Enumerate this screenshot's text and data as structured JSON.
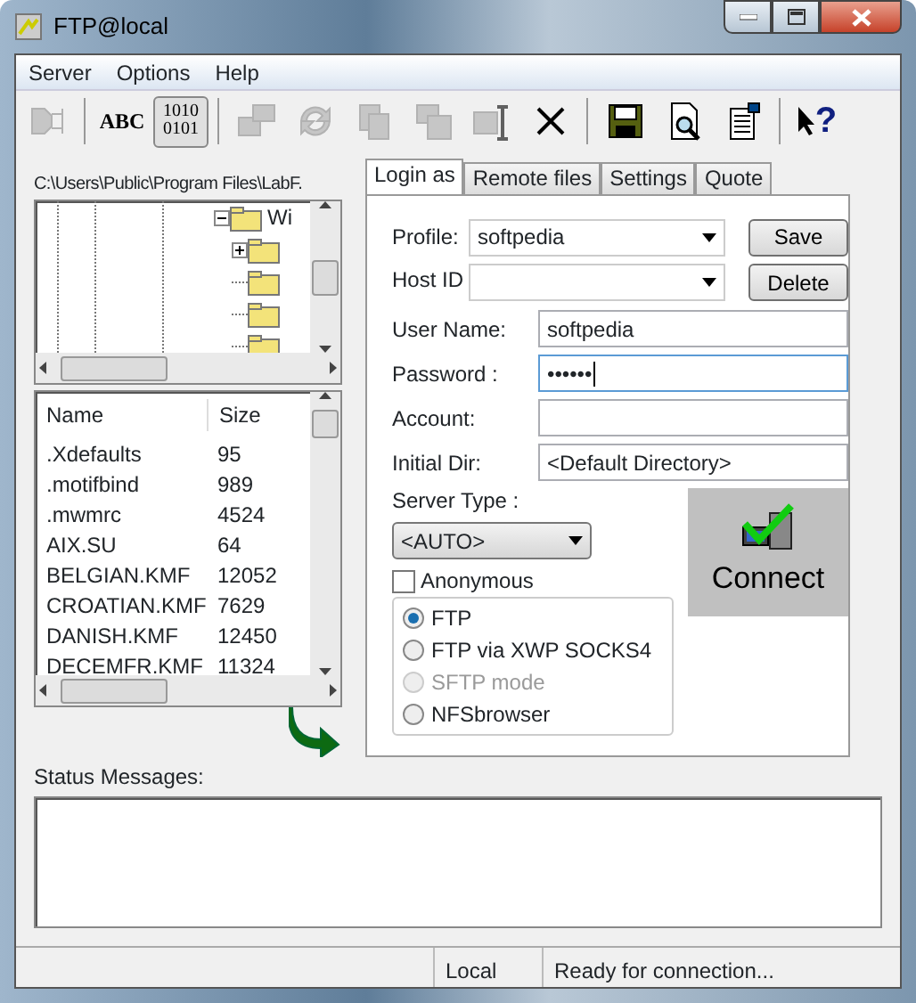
{
  "window": {
    "title": "FTP@local"
  },
  "menu": [
    "Server",
    "Options",
    "Help"
  ],
  "toolbar": [
    {
      "kind": "icon",
      "disabled": true
    },
    {
      "kind": "separator"
    },
    {
      "kind": "text",
      "label": "ABC",
      "pressed": false
    },
    {
      "kind": "text",
      "label": "1010\n0101",
      "pressed": true
    },
    {
      "kind": "separator"
    },
    {
      "kind": "icon",
      "disabled": true
    },
    {
      "kind": "icon",
      "disabled": true
    },
    {
      "kind": "icon",
      "disabled": true
    },
    {
      "kind": "icon",
      "disabled": true
    },
    {
      "kind": "icon",
      "disabled": true
    },
    {
      "kind": "icon",
      "disabled": false
    },
    {
      "kind": "separator"
    },
    {
      "kind": "icon",
      "disabled": false
    },
    {
      "kind": "icon",
      "disabled": false
    },
    {
      "kind": "icon",
      "disabled": false
    },
    {
      "kind": "separator"
    },
    {
      "kind": "help",
      "glyph": "?"
    }
  ],
  "local": {
    "path": "C:\\Users\\Public\\Program Files\\LabF.",
    "tree": [
      {
        "label": "Wi",
        "expanded": true,
        "children": [
          {
            "expandable": true,
            "expanded": false
          },
          {
            "expandable": false
          },
          {
            "expandable": false
          },
          {
            "expandable": false
          }
        ]
      }
    ],
    "columns": [
      "Name",
      "Size"
    ],
    "rows": [
      {
        "name": ".Xdefaults",
        "size": "95"
      },
      {
        "name": ".motifbind",
        "size": "989"
      },
      {
        "name": ".mwmrc",
        "size": "4524"
      },
      {
        "name": "AIX.SU",
        "size": "64"
      },
      {
        "name": "BELGIAN.KMF",
        "size": "12052"
      },
      {
        "name": "CROATIAN.KMF",
        "size": "7629"
      },
      {
        "name": "DANISH.KMF",
        "size": "12450"
      },
      {
        "name": "DECEMFR.KMF",
        "size": "11324"
      }
    ]
  },
  "tabs": [
    {
      "label": "Login as",
      "selected": true
    },
    {
      "label": "Remote files",
      "selected": false
    },
    {
      "label": "Settings",
      "selected": false
    },
    {
      "label": "Quote",
      "selected": false
    }
  ],
  "login": {
    "profile_label": "Profile:",
    "profile": "softpedia",
    "host_label": "Host ID",
    "save": "Save",
    "delete": "Delete",
    "fields": [
      {
        "label": "User Name:",
        "value": "softpedia",
        "focused": false
      },
      {
        "label": "Password :",
        "value": "••••••",
        "focused": true
      },
      {
        "label": "Account:"
      },
      {
        "label": "Initial Dir:",
        "value": "<Default Directory>"
      }
    ],
    "server_type_label": "Server Type :",
    "server_type": "<AUTO>",
    "anonymous": {
      "label": "Anonymous",
      "checked": false
    },
    "modes": [
      {
        "label": "FTP",
        "selected": true,
        "disabled": false
      },
      {
        "label": "FTP via XWP SOCKS4",
        "selected": false,
        "disabled": false
      },
      {
        "label": "SFTP mode",
        "selected": false,
        "disabled": true
      },
      {
        "label": "NFSbrowser",
        "selected": false,
        "disabled": false
      }
    ],
    "connect": "Connect"
  },
  "status_messages_label": "Status Messages:",
  "status_bar": [
    "Local",
    "Ready for connection..."
  ]
}
